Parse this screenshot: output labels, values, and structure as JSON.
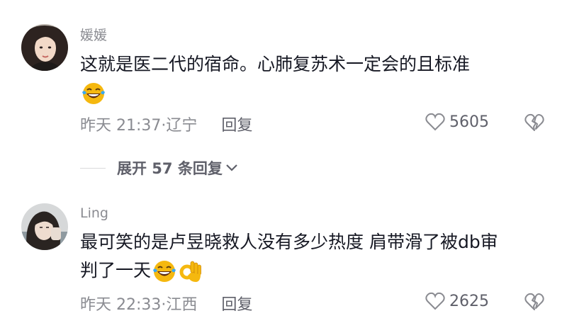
{
  "comments": [
    {
      "username": "媛媛",
      "text": "这就是医二代的宿命。心肺复苏术一定会的且标准",
      "emojis": [
        "laughing-crying-emoji"
      ],
      "meta": "昨天 21:37·辽宁",
      "reply_label": "回复",
      "likes": "5605"
    },
    {
      "username": "Ling",
      "text_line1": "最可笑的是卢昱晓救人没有多少热度 肩带滑了被db审",
      "text_line2": "判了一天",
      "emojis": [
        "laughing-crying-emoji",
        "ok-hand-emoji"
      ],
      "meta": "昨天 22:33·江西",
      "reply_label": "回复",
      "likes": "2625"
    }
  ],
  "expand_replies": {
    "label": "展开 57 条回复"
  },
  "icons": {
    "like": "heart-outline-icon",
    "dislike": "broken-heart-icon",
    "expand": "chevron-down-icon"
  },
  "colors": {
    "text": "#161823",
    "secondary": "#8a8b91",
    "emoji": "#f5b80f"
  }
}
